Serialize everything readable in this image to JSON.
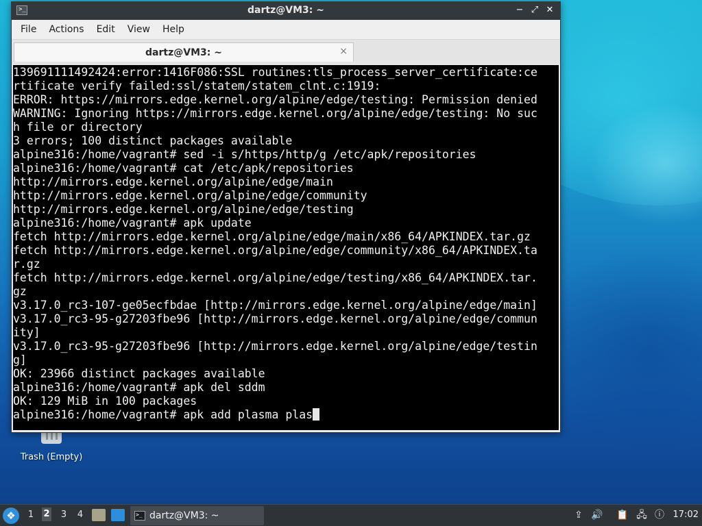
{
  "desktop": {
    "trash_label": "Trash (Empty)"
  },
  "window": {
    "title": "dartz@VM3: ~",
    "controls": {
      "minimize": "−",
      "maximize": "⤢",
      "close": "✕"
    }
  },
  "menubar": {
    "items": [
      "File",
      "Actions",
      "Edit",
      "View",
      "Help"
    ]
  },
  "tabs": [
    {
      "label": "dartz@VM3: ~",
      "close": "×"
    }
  ],
  "terminal": {
    "lines": [
      "139691111492424:error:1416F086:SSL routines:tls_process_server_certificate:ce",
      "rtificate verify failed:ssl/statem/statem_clnt.c:1919:",
      "ERROR: https://mirrors.edge.kernel.org/alpine/edge/testing: Permission denied",
      "WARNING: Ignoring https://mirrors.edge.kernel.org/alpine/edge/testing: No suc",
      "h file or directory",
      "3 errors; 100 distinct packages available",
      "alpine316:/home/vagrant# sed -i s/https/http/g /etc/apk/repositories",
      "alpine316:/home/vagrant# cat /etc/apk/repositories",
      "http://mirrors.edge.kernel.org/alpine/edge/main",
      "http://mirrors.edge.kernel.org/alpine/edge/community",
      "http://mirrors.edge.kernel.org/alpine/edge/testing",
      "alpine316:/home/vagrant# apk update",
      "fetch http://mirrors.edge.kernel.org/alpine/edge/main/x86_64/APKINDEX.tar.gz",
      "fetch http://mirrors.edge.kernel.org/alpine/edge/community/x86_64/APKINDEX.ta",
      "r.gz",
      "fetch http://mirrors.edge.kernel.org/alpine/edge/testing/x86_64/APKINDEX.tar.",
      "gz",
      "v3.17.0_rc3-107-ge05ecfbdae [http://mirrors.edge.kernel.org/alpine/edge/main]",
      "v3.17.0_rc3-95-g27203fbe96 [http://mirrors.edge.kernel.org/alpine/edge/commun",
      "ity]",
      "v3.17.0_rc3-95-g27203fbe96 [http://mirrors.edge.kernel.org/alpine/edge/testin",
      "g]",
      "OK: 23966 distinct packages available",
      "alpine316:/home/vagrant# apk del sddm",
      "OK: 129 MiB in 100 packages",
      "alpine316:/home/vagrant# apk add plasma plas"
    ]
  },
  "taskbar": {
    "workspaces": [
      "1",
      "2",
      "3",
      "4"
    ],
    "active_workspace": "2",
    "task_label": "dartz@VM3: ~",
    "clock": "17:02"
  },
  "colors": {
    "terminal_bg": "#000000",
    "terminal_fg": "#f0f0f0",
    "titlebar_bg": "#33383d",
    "taskbar_bg": "#2e3338"
  }
}
